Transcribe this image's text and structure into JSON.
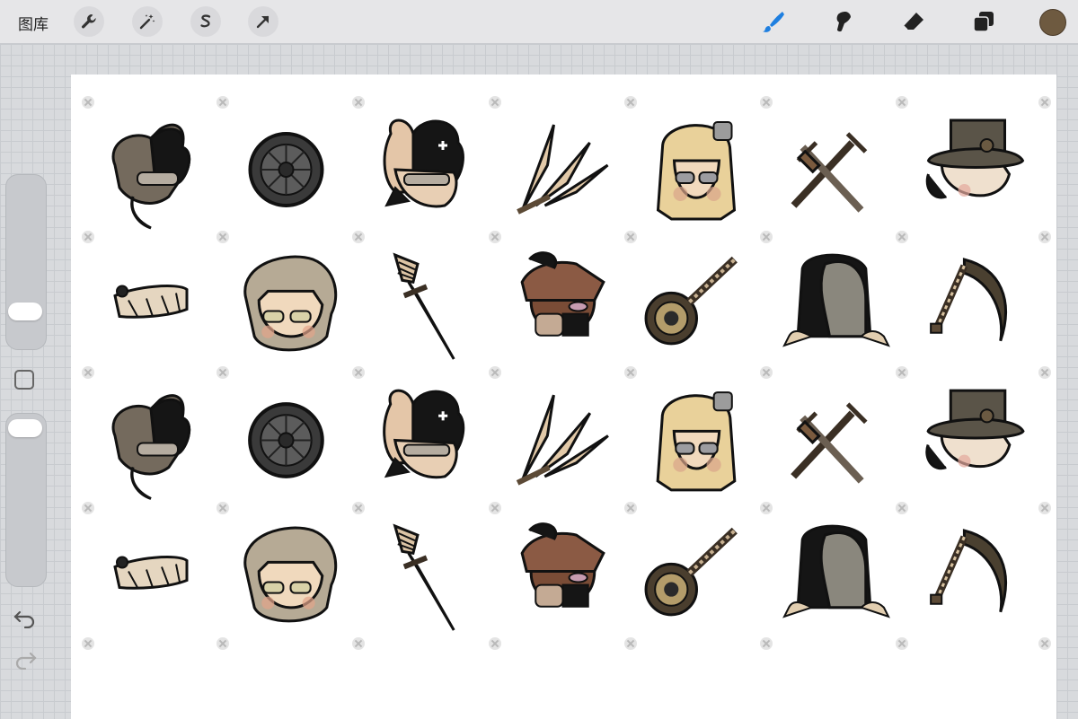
{
  "toolbar": {
    "gallery_label": "图库",
    "left_tools": [
      "wrench-icon",
      "magic-wand-icon",
      "selection-s-icon",
      "transform-arrow-icon"
    ],
    "right_tools": [
      "brush-icon",
      "smudge-icon",
      "eraser-icon",
      "layers-icon"
    ],
    "brush_active_color": "#1e7fe0",
    "current_color": "#6e5a40"
  },
  "sidebar": {
    "controls": [
      "brush-size-slider",
      "modify-button",
      "opacity-slider",
      "undo-button",
      "redo-button"
    ]
  },
  "canvas": {
    "background": "#ffffff",
    "sticker_rows": [
      [
        "masked-figure-head",
        "wheel",
        "plague-doctor-head",
        "claw-blades",
        "blonde-man-head",
        "cross-daggers",
        "tophat-head"
      ],
      [
        "bandage-scarf",
        "curly-hair-head",
        "tall-dagger",
        "pirate-hat-head",
        "round-mace",
        "hood-cloak",
        "scythe"
      ],
      [
        "masked-figure-head",
        "wheel",
        "plague-doctor-head",
        "claw-blades",
        "blonde-man-head",
        "cross-daggers",
        "tophat-head"
      ],
      [
        "bandage-scarf",
        "curly-hair-head",
        "tall-dagger",
        "pirate-hat-head",
        "round-mace",
        "hood-cloak",
        "scythe"
      ]
    ]
  }
}
